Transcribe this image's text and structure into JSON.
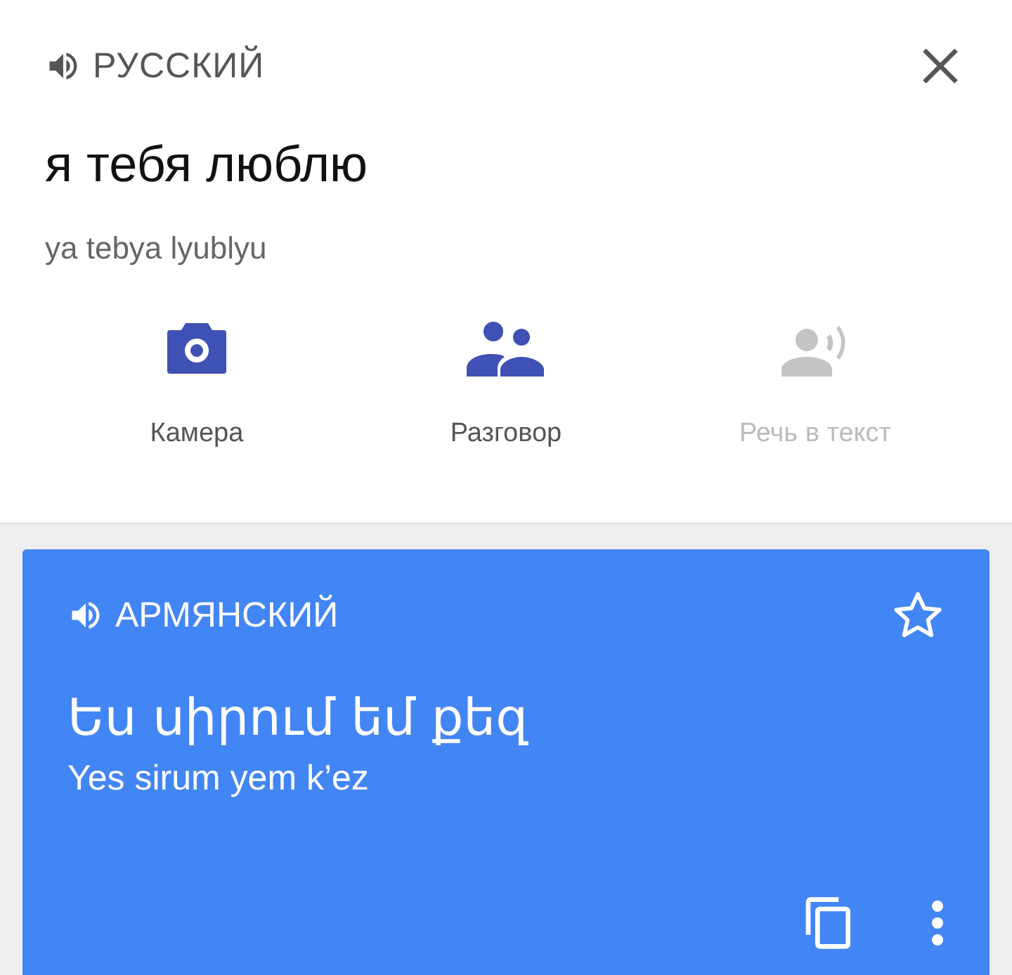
{
  "source": {
    "language": "РУССКИЙ",
    "text": "я тебя люблю",
    "transliteration": "ya tebya lyublyu"
  },
  "actions": [
    {
      "kind": "camera",
      "label": "Камера",
      "disabled": false
    },
    {
      "kind": "conversation",
      "label": "Разговор",
      "disabled": false
    },
    {
      "kind": "speech",
      "label": "Речь в текст",
      "disabled": true
    }
  ],
  "result": {
    "language": "АРМЯНСКИЙ",
    "text": "Ես սիրում եմ քեզ",
    "transliteration": "Yes sirum yem k’ez",
    "starred": false
  }
}
